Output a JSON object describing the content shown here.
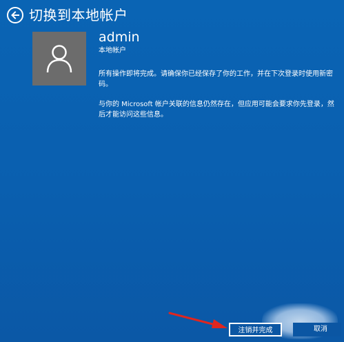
{
  "header": {
    "title": "切换到本地帐户",
    "back_icon": "back-arrow-icon"
  },
  "account": {
    "avatar_icon": "user-avatar-icon",
    "name": "admin",
    "type": "本地帐户"
  },
  "message": {
    "paragraph_1": "所有操作即将完成。请确保你已经保存了你的工作，并在下次登录时使用新密码。",
    "paragraph_2": "与你的 Microsoft 帐户关联的信息仍然存在，但应用可能会要求你先登录，然后才能访问这些信息。"
  },
  "footer": {
    "signout_finish_label": "注销并完成",
    "cancel_label": "取消"
  },
  "colors": {
    "background": "#0a5faf",
    "avatar_tile": "#6c6c6c",
    "text": "#ffffff",
    "annotation_arrow": "#e0261f"
  }
}
